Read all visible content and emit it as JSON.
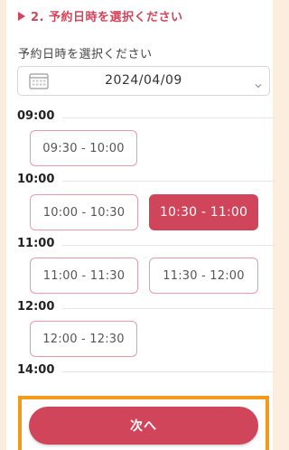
{
  "section": {
    "title": "2. 予約日時を選択ください"
  },
  "date_field": {
    "label": "予約日時を選択ください",
    "value": "2024/04/09"
  },
  "hours": [
    {
      "label": "09:00",
      "slots": [
        {
          "label": "09:30 - 10:00",
          "selected": false
        }
      ]
    },
    {
      "label": "10:00",
      "slots": [
        {
          "label": "10:00 - 10:30",
          "selected": false
        },
        {
          "label": "10:30 - 11:00",
          "selected": true
        }
      ]
    },
    {
      "label": "11:00",
      "slots": [
        {
          "label": "11:00 - 11:30",
          "selected": false
        },
        {
          "label": "11:30 - 12:00",
          "selected": false
        }
      ]
    },
    {
      "label": "12:00",
      "slots": [
        {
          "label": "12:00 - 12:30",
          "selected": false
        }
      ]
    },
    {
      "label": "14:00",
      "slots": []
    }
  ],
  "footer": {
    "next_label": "次へ"
  },
  "colors": {
    "accent": "#d0455a",
    "highlight": "#f39a1a",
    "background": "#fbeedf"
  }
}
